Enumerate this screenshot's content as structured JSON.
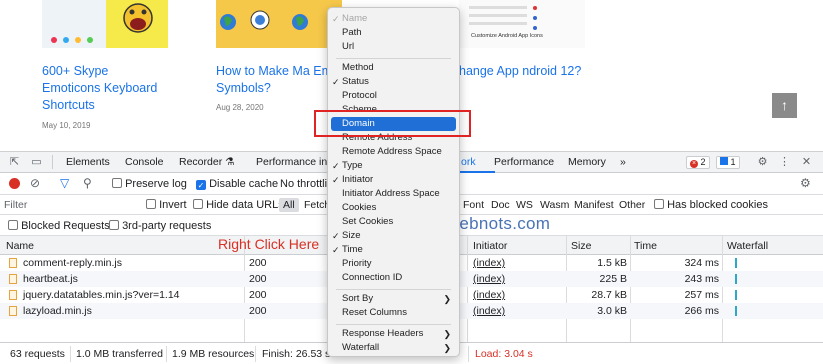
{
  "blog": {
    "cards": [
      {
        "title": "600+ Skype Emoticons Keyboard Shortcuts",
        "date": "May 10, 2019"
      },
      {
        "title": "How to Make Ma Emoji Symbols?",
        "date": "Aug 28, 2020"
      },
      {
        "title": "hange App ndroid 12?",
        "thumb_caption": "Customize Android App Icons"
      }
    ],
    "scroll_top_icon": "up-arrow-icon"
  },
  "watermark": "www.webnots.com",
  "annotation": "Right Click Here",
  "devtools": {
    "tabs": [
      "Elements",
      "Console",
      "Recorder ⚗",
      "Performance ins",
      "ork",
      "Performance",
      "Memory",
      "»"
    ],
    "active_tab": "ork",
    "badges": {
      "errors": "2",
      "info": "1"
    },
    "toolbar": {
      "preserve_log": "Preserve log",
      "disable_cache": "Disable cache",
      "throttling": "No throttlin"
    },
    "filter": {
      "placeholder": "Filter",
      "invert": "Invert",
      "hide_data_urls": "Hide data URLs",
      "types": [
        "All",
        "Fetch",
        "Font",
        "Doc",
        "WS",
        "Wasm",
        "Manifest",
        "Other"
      ],
      "has_blocked_cookies": "Has blocked cookies"
    },
    "blocked": {
      "blocked_requests": "Blocked Requests",
      "third_party": "3rd-party requests"
    },
    "columns": {
      "name": "Name",
      "initiator": "Initiator",
      "size": "Size",
      "time": "Time",
      "waterfall": "Waterfall"
    },
    "rows": [
      {
        "name": "comment-reply.min.js",
        "status": "200",
        "initiator": "(index)",
        "size": "1.5 kB",
        "time": "324 ms"
      },
      {
        "name": "heartbeat.js",
        "status": "200",
        "initiator": "(index)",
        "size": "225 B",
        "time": "243 ms"
      },
      {
        "name": "jquery.datatables.min.js?ver=1.14",
        "status": "200",
        "initiator": "(index)",
        "size": "28.7 kB",
        "time": "257 ms"
      },
      {
        "name": "lazyload.min.js",
        "status": "200",
        "initiator": "(index)",
        "size": "3.0 kB",
        "time": "266 ms"
      }
    ],
    "status": {
      "requests": "63 requests",
      "transferred": "1.0 MB transferred",
      "resources": "1.9 MB resources",
      "finish": "Finish: 26.53 s",
      "load": "Load: 3.04 s"
    }
  },
  "context_menu": {
    "items": [
      {
        "label": "Name",
        "checked": true,
        "disabled": true
      },
      {
        "label": "Path"
      },
      {
        "label": "Url"
      },
      {
        "label": "Method"
      },
      {
        "label": "Status",
        "checked": true
      },
      {
        "label": "Protocol"
      },
      {
        "label": "Scheme"
      },
      {
        "label": "Domain",
        "highlighted": true
      },
      {
        "label": "Remote Address"
      },
      {
        "label": "Remote Address Space"
      },
      {
        "label": "Type",
        "checked": true
      },
      {
        "label": "Initiator",
        "checked": true
      },
      {
        "label": "Initiator Address Space"
      },
      {
        "label": "Cookies"
      },
      {
        "label": "Set Cookies"
      },
      {
        "label": "Size",
        "checked": true
      },
      {
        "label": "Time",
        "checked": true
      },
      {
        "label": "Priority"
      },
      {
        "label": "Connection ID"
      },
      {
        "label": "Sort By",
        "submenu": true
      },
      {
        "label": "Reset Columns"
      },
      {
        "label": "Response Headers",
        "submenu": true
      },
      {
        "label": "Waterfall",
        "submenu": true
      }
    ]
  }
}
